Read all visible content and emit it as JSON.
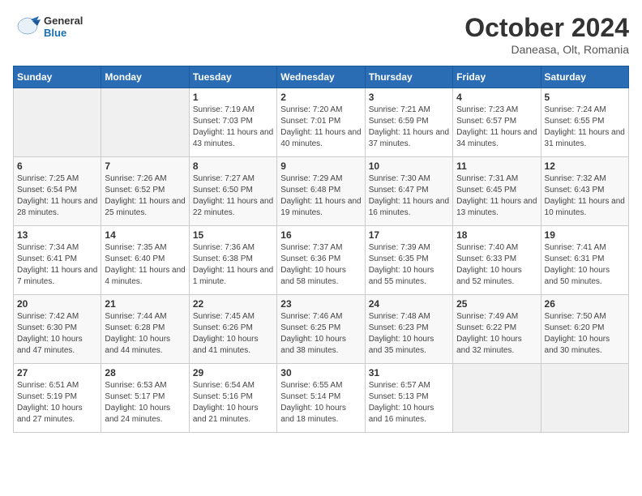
{
  "header": {
    "logo": {
      "general": "General",
      "blue": "Blue"
    },
    "title": "October 2024",
    "subtitle": "Daneasa, Olt, Romania"
  },
  "calendar": {
    "days_of_week": [
      "Sunday",
      "Monday",
      "Tuesday",
      "Wednesday",
      "Thursday",
      "Friday",
      "Saturday"
    ],
    "weeks": [
      [
        {
          "day": "",
          "info": ""
        },
        {
          "day": "",
          "info": ""
        },
        {
          "day": "1",
          "info": "Sunrise: 7:19 AM\nSunset: 7:03 PM\nDaylight: 11 hours and 43 minutes."
        },
        {
          "day": "2",
          "info": "Sunrise: 7:20 AM\nSunset: 7:01 PM\nDaylight: 11 hours and 40 minutes."
        },
        {
          "day": "3",
          "info": "Sunrise: 7:21 AM\nSunset: 6:59 PM\nDaylight: 11 hours and 37 minutes."
        },
        {
          "day": "4",
          "info": "Sunrise: 7:23 AM\nSunset: 6:57 PM\nDaylight: 11 hours and 34 minutes."
        },
        {
          "day": "5",
          "info": "Sunrise: 7:24 AM\nSunset: 6:55 PM\nDaylight: 11 hours and 31 minutes."
        }
      ],
      [
        {
          "day": "6",
          "info": "Sunrise: 7:25 AM\nSunset: 6:54 PM\nDaylight: 11 hours and 28 minutes."
        },
        {
          "day": "7",
          "info": "Sunrise: 7:26 AM\nSunset: 6:52 PM\nDaylight: 11 hours and 25 minutes."
        },
        {
          "day": "8",
          "info": "Sunrise: 7:27 AM\nSunset: 6:50 PM\nDaylight: 11 hours and 22 minutes."
        },
        {
          "day": "9",
          "info": "Sunrise: 7:29 AM\nSunset: 6:48 PM\nDaylight: 11 hours and 19 minutes."
        },
        {
          "day": "10",
          "info": "Sunrise: 7:30 AM\nSunset: 6:47 PM\nDaylight: 11 hours and 16 minutes."
        },
        {
          "day": "11",
          "info": "Sunrise: 7:31 AM\nSunset: 6:45 PM\nDaylight: 11 hours and 13 minutes."
        },
        {
          "day": "12",
          "info": "Sunrise: 7:32 AM\nSunset: 6:43 PM\nDaylight: 11 hours and 10 minutes."
        }
      ],
      [
        {
          "day": "13",
          "info": "Sunrise: 7:34 AM\nSunset: 6:41 PM\nDaylight: 11 hours and 7 minutes."
        },
        {
          "day": "14",
          "info": "Sunrise: 7:35 AM\nSunset: 6:40 PM\nDaylight: 11 hours and 4 minutes."
        },
        {
          "day": "15",
          "info": "Sunrise: 7:36 AM\nSunset: 6:38 PM\nDaylight: 11 hours and 1 minute."
        },
        {
          "day": "16",
          "info": "Sunrise: 7:37 AM\nSunset: 6:36 PM\nDaylight: 10 hours and 58 minutes."
        },
        {
          "day": "17",
          "info": "Sunrise: 7:39 AM\nSunset: 6:35 PM\nDaylight: 10 hours and 55 minutes."
        },
        {
          "day": "18",
          "info": "Sunrise: 7:40 AM\nSunset: 6:33 PM\nDaylight: 10 hours and 52 minutes."
        },
        {
          "day": "19",
          "info": "Sunrise: 7:41 AM\nSunset: 6:31 PM\nDaylight: 10 hours and 50 minutes."
        }
      ],
      [
        {
          "day": "20",
          "info": "Sunrise: 7:42 AM\nSunset: 6:30 PM\nDaylight: 10 hours and 47 minutes."
        },
        {
          "day": "21",
          "info": "Sunrise: 7:44 AM\nSunset: 6:28 PM\nDaylight: 10 hours and 44 minutes."
        },
        {
          "day": "22",
          "info": "Sunrise: 7:45 AM\nSunset: 6:26 PM\nDaylight: 10 hours and 41 minutes."
        },
        {
          "day": "23",
          "info": "Sunrise: 7:46 AM\nSunset: 6:25 PM\nDaylight: 10 hours and 38 minutes."
        },
        {
          "day": "24",
          "info": "Sunrise: 7:48 AM\nSunset: 6:23 PM\nDaylight: 10 hours and 35 minutes."
        },
        {
          "day": "25",
          "info": "Sunrise: 7:49 AM\nSunset: 6:22 PM\nDaylight: 10 hours and 32 minutes."
        },
        {
          "day": "26",
          "info": "Sunrise: 7:50 AM\nSunset: 6:20 PM\nDaylight: 10 hours and 30 minutes."
        }
      ],
      [
        {
          "day": "27",
          "info": "Sunrise: 6:51 AM\nSunset: 5:19 PM\nDaylight: 10 hours and 27 minutes."
        },
        {
          "day": "28",
          "info": "Sunrise: 6:53 AM\nSunset: 5:17 PM\nDaylight: 10 hours and 24 minutes."
        },
        {
          "day": "29",
          "info": "Sunrise: 6:54 AM\nSunset: 5:16 PM\nDaylight: 10 hours and 21 minutes."
        },
        {
          "day": "30",
          "info": "Sunrise: 6:55 AM\nSunset: 5:14 PM\nDaylight: 10 hours and 18 minutes."
        },
        {
          "day": "31",
          "info": "Sunrise: 6:57 AM\nSunset: 5:13 PM\nDaylight: 10 hours and 16 minutes."
        },
        {
          "day": "",
          "info": ""
        },
        {
          "day": "",
          "info": ""
        }
      ]
    ]
  }
}
